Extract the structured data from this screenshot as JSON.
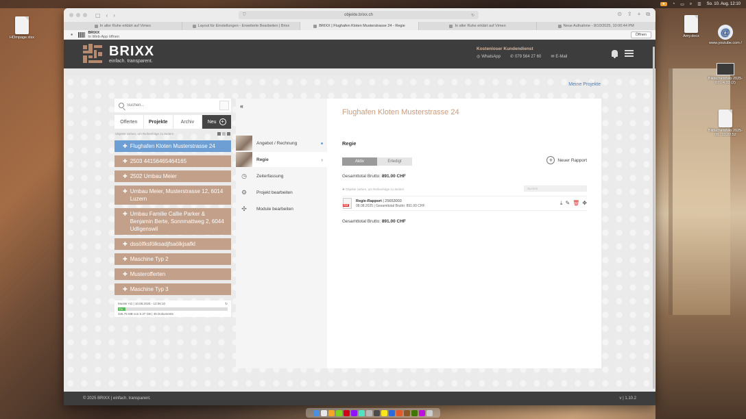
{
  "menubar": {
    "right_icons": [
      "battery-icon",
      "wifi-icon",
      "search-icon",
      "control-center-icon"
    ],
    "clock": "So. 10. Aug. 12:10"
  },
  "desktop": {
    "icons": [
      {
        "label": "HOmpage.xlsx",
        "kind": "file"
      },
      {
        "label": "Amy.docx",
        "kind": "file"
      },
      {
        "label": "www.youtube.com /",
        "kind": "link"
      },
      {
        "label": "Bildschirmfoto 2025-07...4.33 (2)",
        "kind": "thumb"
      },
      {
        "label": "Bildschirmfoto 2025-08...11.22.52",
        "kind": "file"
      }
    ]
  },
  "browser": {
    "url": "objekte.brixx.ch",
    "tabs": [
      {
        "label": "In aller Ruhe erklärt auf Vimeo",
        "active": false
      },
      {
        "label": "Layout für Einstellungen - Erweiterte Bearbeiten | Brixx",
        "active": false
      },
      {
        "label": "BRIXX | Flughafen Kloten Musterstrasse 24 - Regie",
        "active": true
      },
      {
        "label": "In aller Ruhe erklärt auf Vimeo",
        "active": false
      },
      {
        "label": "Neue Aufnahme - 8/10/2025, 10:00:44 PM",
        "active": false
      }
    ],
    "infobar": {
      "app_name": "BRIXX",
      "subtitle": "In Web-App öffnen",
      "open_label": "Öffnen"
    }
  },
  "header": {
    "brand_name": "BRIXX",
    "brand_tagline": "einfach. transparent.",
    "support_title": "Kostenloser Kundendienst",
    "whatsapp": "WhatsApp",
    "phone": "079 564 27 60",
    "email": "E-Mail"
  },
  "content": {
    "my_projects_link": "Meine Projekte"
  },
  "sidebar": {
    "search_placeholder": "Suchen...",
    "tabs": [
      {
        "label": "Offerten",
        "active": false
      },
      {
        "label": "Projekte",
        "active": true
      },
      {
        "label": "Archiv",
        "active": false
      }
    ],
    "new_label": "Neu",
    "list_hint": "Objekte ziehen, um Reihenfolge zu ändern",
    "projects": [
      {
        "label": "Flughafen Kloten Musterstrasse 24",
        "active": true
      },
      {
        "label": "2503 44156465464165",
        "active": false
      },
      {
        "label": "2502 Umbau Meier",
        "active": false
      },
      {
        "label": "Umbau Meier, Musterstrasse 12, 6014 Luzern",
        "active": false
      },
      {
        "label": "Umbau Familie Callie Parker & Benjamin Berte, Sonnmattweg 2, 6044 Udligenswil",
        "active": false
      },
      {
        "label": "dssölfksfölksadjfsaölkjsafkl",
        "active": false
      },
      {
        "label": "Maschine Typ 2",
        "active": false
      },
      {
        "label": "Musterofferten",
        "active": false
      },
      {
        "label": "Maschine Typ 3",
        "active": false
      }
    ],
    "storage": {
      "company_line": "Muster AG | 10.08.2025 - 12:06:10",
      "percent_label": "7%",
      "percent": 7,
      "usage_line": "346.75 MB von 5.37 GB | 45 Dokumente"
    }
  },
  "panel": {
    "nav": [
      {
        "label": "Angebot / Rechnung",
        "icon": "photo-thumbnail",
        "active": false
      },
      {
        "label": "Regie",
        "icon": "photo-thumbnail",
        "active": true
      },
      {
        "label": "Zeiterfassung",
        "icon": "clock-icon",
        "active": false
      },
      {
        "label": "Projekt bearbeiten",
        "icon": "gear-icon",
        "active": false
      },
      {
        "label": "Module bearbeiten",
        "icon": "puzzle-icon",
        "active": false
      }
    ],
    "project_title": "Flughafen Kloten Musterstrasse 24",
    "section_title": "Regie",
    "status_tabs": [
      {
        "label": "Aktiv",
        "active": true
      },
      {
        "label": "Erledigt",
        "active": false
      }
    ],
    "new_report_label": "Neuer Rapport",
    "total_label": "Gesamttotal Brutto:",
    "total_value": "891.00 CHF",
    "drag_hint": "Objekte ziehen, um Reihenfolge zu ändern",
    "filter_placeholder": "Suchen",
    "reports": [
      {
        "title": "Regie-Rapport",
        "number": "25653003",
        "date": "08.08.2025",
        "gross_label": "Gesamttotal Brutto: 891.00 CHF"
      }
    ]
  },
  "footer": {
    "copyright": "© 2025 BRIXX | einfach. transparent.",
    "version": "v | 1.10.2"
  },
  "colors": {
    "accent_brown": "#c2a08a",
    "active_blue": "#6e9fd4",
    "header_dark": "#3d3d3d",
    "title_brown": "#c89b7c"
  }
}
